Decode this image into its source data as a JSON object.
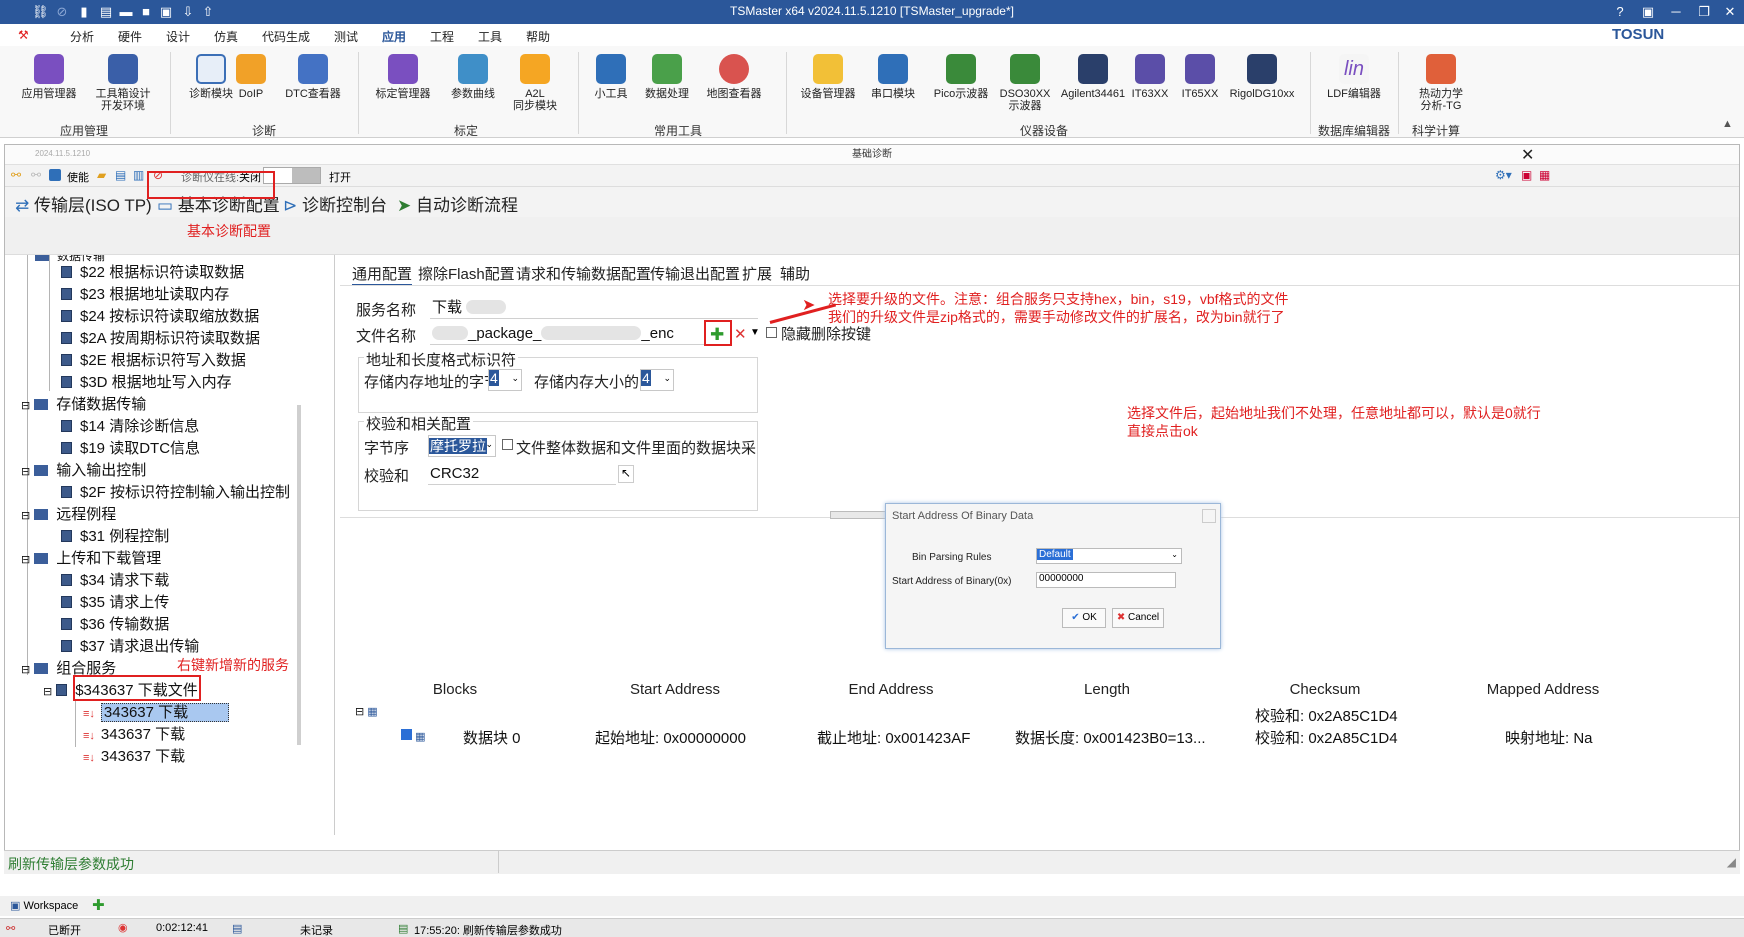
{
  "window": {
    "title": "TSMaster x64 v2024.11.5.1210 [TSMaster_upgrade*]",
    "controls": [
      "?",
      "▣",
      "─",
      "❐",
      "✕"
    ]
  },
  "menu": {
    "items": [
      "分析",
      "硬件",
      "设计",
      "仿真",
      "代码生成",
      "测试",
      "应用",
      "工程",
      "工具",
      "帮助"
    ],
    "active": "应用",
    "brand": "TOSUN"
  },
  "ribbon": {
    "buttons": [
      {
        "label": "应用管理器"
      },
      {
        "label": "工具箱设计\n开发环境"
      },
      {
        "label": "诊断模块"
      },
      {
        "label": "DoIP"
      },
      {
        "label": "DTC查看器"
      },
      {
        "label": "标定管理器"
      },
      {
        "label": "参数曲线"
      },
      {
        "label": "A2L\n同步模块"
      },
      {
        "label": "小工具"
      },
      {
        "label": "数据处理"
      },
      {
        "label": "地图查看器"
      },
      {
        "label": "设备管理器"
      },
      {
        "label": "串口模块"
      },
      {
        "label": "Pico示波器"
      },
      {
        "label": "DSO30XX\n示波器"
      },
      {
        "label": "Agilent34461"
      },
      {
        "label": "IT63XX"
      },
      {
        "label": "IT65XX"
      },
      {
        "label": "RigolDG10xx"
      },
      {
        "label": "LDF编辑器"
      },
      {
        "label": "热动力学\n分析-TG"
      }
    ],
    "groups": [
      "应用管理",
      "诊断",
      "标定",
      "常用工具",
      "仪器设备",
      "数据库编辑器",
      "科学计算"
    ]
  },
  "doc": {
    "title": "基础诊断",
    "version_small": "2024.11.5.1210",
    "toolbar": {
      "enable": "使能",
      "online_label": "诊断仪在线:",
      "online_state": "关闭",
      "open": "打开"
    },
    "tabs": [
      "传输层(ISO TP)",
      "基本诊断配置",
      "诊断控制台",
      "自动诊断流程"
    ],
    "annotation_tab": "基本诊断配置"
  },
  "tree": {
    "top_partial": "数据传输",
    "items": [
      {
        "label": "$22 根据标识符读取数据",
        "kind": "leaf"
      },
      {
        "label": "$23 根据地址读取内存",
        "kind": "leaf"
      },
      {
        "label": "$24 按标识符读取缩放数据",
        "kind": "leaf"
      },
      {
        "label": "$2A 按周期标识符读取数据",
        "kind": "leaf"
      },
      {
        "label": "$2E 根据标识符写入数据",
        "kind": "leaf"
      },
      {
        "label": "$3D 根据地址写入内存",
        "kind": "leaf"
      },
      {
        "label": "存储数据传输",
        "kind": "folder"
      },
      {
        "label": "$14 清除诊断信息",
        "kind": "leaf"
      },
      {
        "label": "$19 读取DTC信息",
        "kind": "leaf"
      },
      {
        "label": "输入输出控制",
        "kind": "folder"
      },
      {
        "label": "$2F 按标识符控制输入输出控制",
        "kind": "leaf"
      },
      {
        "label": "远程例程",
        "kind": "folder"
      },
      {
        "label": "$31 例程控制",
        "kind": "leaf"
      },
      {
        "label": "上传和下载管理",
        "kind": "folder"
      },
      {
        "label": "$34 请求下载",
        "kind": "leaf"
      },
      {
        "label": "$35 请求上传",
        "kind": "leaf"
      },
      {
        "label": "$36 传输数据",
        "kind": "leaf"
      },
      {
        "label": "$37 请求退出传输",
        "kind": "leaf"
      },
      {
        "label": "组合服务",
        "kind": "folder"
      },
      {
        "label": "$343637 下载文件",
        "kind": "leaf"
      },
      {
        "label": "343637 下载",
        "kind": "step"
      },
      {
        "label": "343637 下载",
        "kind": "step"
      },
      {
        "label": "343637 下载",
        "kind": "step"
      }
    ],
    "annotation_new_service": "右键新增新的服务"
  },
  "subtabs": [
    "通用配置",
    "擦除Flash配置",
    "请求和传输数据配置",
    "传输退出配置",
    "扩展",
    "辅助"
  ],
  "form": {
    "service_name_label": "服务名称",
    "service_name_value": "下载",
    "file_name_label": "文件名称",
    "file_name_value": "_package_",
    "file_name_suffix": "_enc",
    "hide_delete_label": "隐藏删除按键",
    "addr_format_group": "地址和长度格式标识符",
    "mem_addr_bytes_label": "存储内存地址的字节",
    "mem_addr_bytes_value": "4",
    "mem_size_bytes_label": "存储内存大小的字",
    "mem_size_bytes_value": "4",
    "checksum_group": "校验和相关配置",
    "byte_order_label": "字节序",
    "byte_order_value": "摩托罗拉",
    "whole_file_label": "文件整体数据和文件里面的数据块采用",
    "checksum_label": "校验和",
    "checksum_value": "CRC32"
  },
  "annotations": {
    "select_file_line1": "选择要升级的文件。注意：组合服务只支持hex，bin，s19，vbf格式的文件",
    "select_file_line2": "我们的升级文件是zip格式的，需要手动修改文件的扩展名，改为bin就行了",
    "start_addr_line1": "选择文件后，起始地址我们不处理，任意地址都可以，默认是0就行",
    "start_addr_line2": "直接点击ok"
  },
  "dialog": {
    "title": "Start Address Of Binary Data",
    "bin_rules_label": "Bin Parsing Rules",
    "bin_rules_value": "Default",
    "start_addr_label": "Start Address of Binary(0x)",
    "start_addr_value": "00000000",
    "ok": "OK",
    "cancel": "Cancel"
  },
  "grid": {
    "headers": [
      "Blocks",
      "Start Address",
      "End Address",
      "Length",
      "Checksum",
      "Mapped Address"
    ],
    "summary_checksum": "校验和: 0x2A85C1D4",
    "row": {
      "block": "数据块 0",
      "start": "起始地址: 0x00000000",
      "end": "截止地址: 0x001423AF",
      "length": "数据长度: 0x001423B0=13...",
      "checksum": "校验和: 0x2A85C1D4",
      "mapped": "映射地址: Na"
    }
  },
  "status": {
    "message": "刷新传输层参数成功",
    "workspace": "Workspace",
    "disconnected": "已断开",
    "timer": "0:02:12:41",
    "not_recorded": "未记录",
    "log": "17:55:20: 刷新传输层参数成功"
  },
  "colors": {
    "titlebar": "#2b579a",
    "annotation": "#e02020",
    "accent": "#2b579a"
  }
}
